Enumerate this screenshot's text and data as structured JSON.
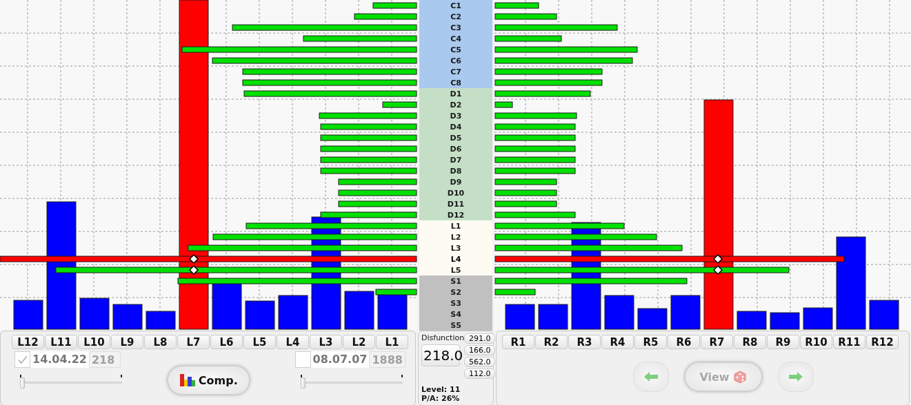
{
  "left_panel": {
    "columns": [
      {
        "label": "L12",
        "selected": false
      },
      {
        "label": "L11",
        "selected": false
      },
      {
        "label": "L10",
        "selected": false
      },
      {
        "label": "L9",
        "selected": false
      },
      {
        "label": "L8",
        "selected": false
      },
      {
        "label": "L7",
        "selected": true
      },
      {
        "label": "L6",
        "selected": false
      },
      {
        "label": "L5",
        "selected": false
      },
      {
        "label": "L4",
        "selected": false
      },
      {
        "label": "L3",
        "selected": false
      },
      {
        "label": "L2",
        "selected": false
      },
      {
        "label": "L1",
        "selected": false
      }
    ],
    "date_a": {
      "checked": true,
      "date": "14.04.22",
      "count": "218"
    },
    "slider_a": {
      "level": 0
    },
    "compare_button": "Comp.",
    "date_b": {
      "checked": false,
      "date": "08.07.07",
      "count": "1888"
    },
    "slider_b": {
      "level": 0
    }
  },
  "categories": [
    {
      "color": "#a9c9ee",
      "labels": [
        {
          "label": "C1",
          "selected": false
        },
        {
          "label": "C2",
          "selected": false
        },
        {
          "label": "C3",
          "selected": false
        },
        {
          "label": "C4",
          "selected": false
        },
        {
          "label": "C5",
          "selected": false
        },
        {
          "label": "C6",
          "selected": false
        },
        {
          "label": "C7",
          "selected": false
        },
        {
          "label": "C8",
          "selected": false
        }
      ]
    },
    {
      "color": "#c5dfc7",
      "labels": [
        {
          "label": "D1",
          "selected": false
        },
        {
          "label": "D2",
          "selected": false
        },
        {
          "label": "D3",
          "selected": false
        },
        {
          "label": "D4",
          "selected": false
        },
        {
          "label": "D5",
          "selected": false
        },
        {
          "label": "D6",
          "selected": false
        },
        {
          "label": "D7",
          "selected": false
        },
        {
          "label": "D8",
          "selected": false
        },
        {
          "label": "D9",
          "selected": false
        },
        {
          "label": "D10",
          "selected": false
        },
        {
          "label": "D11",
          "selected": false
        },
        {
          "label": "D12",
          "selected": false
        }
      ]
    },
    {
      "color": "#fdfbf2",
      "labels": [
        {
          "label": "L1",
          "selected": false
        },
        {
          "label": "L2",
          "selected": false
        },
        {
          "label": "L3",
          "selected": false
        },
        {
          "label": "L4",
          "selected": true
        },
        {
          "label": "L5",
          "selected": false
        }
      ]
    },
    {
      "color": "#c0c0c0",
      "labels": [
        {
          "label": "S1",
          "selected": false
        },
        {
          "label": "S2",
          "selected": false
        },
        {
          "label": "S3",
          "selected": false
        },
        {
          "label": "S4",
          "selected": false
        },
        {
          "label": "S5",
          "selected": false
        }
      ]
    }
  ],
  "summary": {
    "title": "Disfunction",
    "value": "218.0",
    "readings": [
      "291.0",
      "166.0",
      "562.0",
      "112.0"
    ],
    "level_text": "Level: 11",
    "pa_text": "P/A: 26%"
  },
  "right_panel": {
    "columns": [
      {
        "label": "R1",
        "selected": false
      },
      {
        "label": "R2",
        "selected": false
      },
      {
        "label": "R3",
        "selected": false
      },
      {
        "label": "R4",
        "selected": false
      },
      {
        "label": "R5",
        "selected": false
      },
      {
        "label": "R6",
        "selected": false
      },
      {
        "label": "R7",
        "selected": true
      },
      {
        "label": "R8",
        "selected": false
      },
      {
        "label": "R9",
        "selected": false
      },
      {
        "label": "R10",
        "selected": false
      },
      {
        "label": "R11",
        "selected": false
      },
      {
        "label": "R12",
        "selected": false
      }
    ],
    "view_button": {
      "label": "View",
      "disabled": true
    }
  }
}
